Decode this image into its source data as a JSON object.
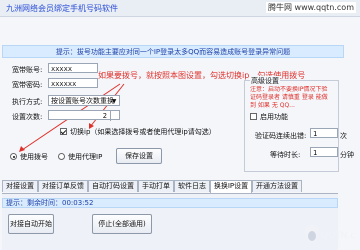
{
  "window": {
    "title": "九洲网络会员绑定手机号码软件",
    "watermark_top": "腾牛网 www.qqtn.com"
  },
  "tip": {
    "text": "提示：拔号功能主要应对同一个IP登录太多QQ而容易造成账号登录异常问题"
  },
  "form": {
    "account_label": "宽带账号:",
    "account_value": "xxxxx",
    "password_label": "宽带密码:",
    "password_value": "xxxxxx",
    "exec_label": "执行方式:",
    "exec_value": "按设置账号次数重换",
    "count_label": "设置次数:",
    "count_value": "2",
    "switch_ip_label": "切换ip（如果选择拨号或者使用代理ip请勾选）",
    "switch_ip_checked": true
  },
  "annotation": {
    "text": "如果要拨号，就按照本图设置，勾选切换ip，勾选使用拨号"
  },
  "network": {
    "use_dialup_label": "使用拨号",
    "use_dialup_checked": true,
    "use_proxy_label": "使用代理IP",
    "use_proxy_checked": false,
    "save_button": "保存设置"
  },
  "captcha": {
    "group_title": "高级设置",
    "warning_text": "注意：启动不要换IP情况下验证码登录者 请慎重 登录 能做到 如果 无  QQ...",
    "enable_label": "启用功能",
    "enable_checked": false,
    "retry_label": "验证码连续出错:",
    "retry_value": "1",
    "retry_unit": "次",
    "wait_label": "等待时长:",
    "wait_value": "1",
    "wait_unit": "分钟"
  },
  "tabs": [
    {
      "label": "对接设置"
    },
    {
      "label": "对接订单反馈"
    },
    {
      "label": "自动打码设置"
    },
    {
      "label": "手动打单"
    },
    {
      "label": "软件日志"
    },
    {
      "label": "换换IP设置"
    },
    {
      "label": "开通方法设置"
    }
  ],
  "status": {
    "text": "提示：剩余时间：00:03:52"
  },
  "actions": {
    "start_label": "对接自动开始",
    "stop_label": "停止(全部通用)"
  },
  "watermark_logo": {
    "text": "QQTN.com"
  },
  "colors": {
    "annotation_red": "#e0302a",
    "tip_blue": "#1e40a8",
    "tip_bg": "#d9ecff"
  }
}
